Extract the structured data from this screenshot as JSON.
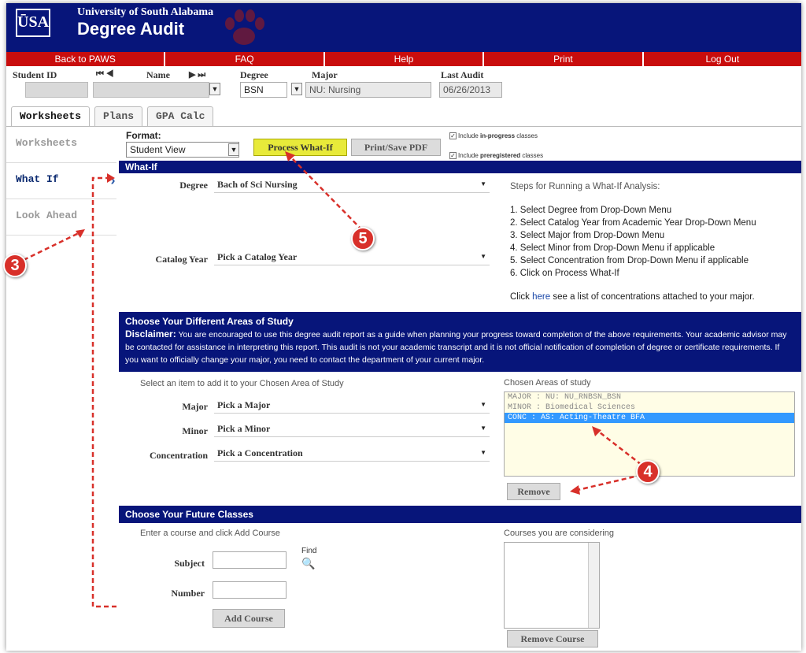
{
  "header": {
    "logo_text": "USA",
    "university": "University of South Alabama",
    "app_title": "Degree Audit"
  },
  "nav": {
    "items": [
      {
        "label": "Back to PAWS"
      },
      {
        "label": "FAQ"
      },
      {
        "label": "Help"
      },
      {
        "label": "Print"
      },
      {
        "label": "Log Out"
      }
    ]
  },
  "student_info": {
    "student_id_label": "Student ID",
    "name_label": "Name",
    "degree_label": "Degree",
    "degree_value": "BSN",
    "major_label": "Major",
    "major_value": "NU: Nursing",
    "last_audit_label": "Last Audit",
    "last_audit_value": "06/26/2013"
  },
  "tabs": [
    {
      "label": "Worksheets"
    },
    {
      "label": "Plans"
    },
    {
      "label": "GPA Calc"
    }
  ],
  "sidebar": {
    "items": [
      {
        "label": "Worksheets"
      },
      {
        "label": "What If"
      },
      {
        "label": "Look Ahead"
      }
    ]
  },
  "toolbar": {
    "format_label": "Format:",
    "format_value": "Student View",
    "process_label": "Process What-If",
    "print_label": "Print/Save PDF",
    "include_inprogress_pre": "Include ",
    "include_inprogress_bold": "in-progress",
    "include_inprogress_post": " classes",
    "include_prereg_pre": "Include ",
    "include_prereg_bold": "preregistered",
    "include_prereg_post": " classes"
  },
  "whatif": {
    "header": "What-If",
    "degree_label": "Degree",
    "degree_value": "Bach of Sci Nursing",
    "catalog_label": "Catalog Year",
    "catalog_value": "Pick a Catalog Year",
    "steps_title": "Steps for Running a What-If Analysis:",
    "steps": [
      "1. Select Degree from Drop-Down Menu",
      "2. Select Catalog Year from Academic Year Drop-Down Menu",
      "3. Select Major from Drop-Down Menu",
      "4. Select Minor from Drop-Down Menu if applicable",
      "5. Select Concentration from Drop-Down Menu if applicable",
      "6. Click on Process What-If"
    ],
    "click_here_pre": "Click ",
    "click_here_link": "here",
    "click_here_post": " see a list of concentrations attached to your major."
  },
  "areas": {
    "header": "Choose Your Different Areas of Study",
    "disclaimer_label": "Disclaimer:",
    "disclaimer_text": "You are encouraged to use this degree audit report as a guide when planning your progress toward completion of the above requirements. Your academic advisor may be contacted for assistance in interpreting this report. This audit is not your academic transcript and it is not official notification of completion of degree or certificate requirements. If you want to officially change your major, you need to contact the department of your current major.",
    "select_prompt": "Select an item to add it to your Chosen Area of Study",
    "major_label": "Major",
    "major_value": "Pick a Major",
    "minor_label": "Minor",
    "minor_value": "Pick a Minor",
    "conc_label": "Concentration",
    "conc_value": "Pick a Concentration",
    "chosen_title": "Chosen Areas of study",
    "chosen_items": [
      "MAJOR : NU: NU_RNBSN_BSN",
      "MINOR : Biomedical Sciences",
      "CONC : AS: Acting-Theatre BFA"
    ],
    "remove_label": "Remove"
  },
  "future": {
    "header": "Choose Your Future Classes",
    "prompt": "Enter a course and click Add Course",
    "subject_label": "Subject",
    "number_label": "Number",
    "find_label": "Find",
    "add_label": "Add Course",
    "considering_title": "Courses you are considering",
    "remove_label": "Remove Course"
  },
  "annotations": {
    "a3": "3",
    "a4": "4",
    "a5": "5"
  },
  "colors": {
    "banner": "#07157a",
    "nav": "#c90d0d",
    "process_button": "#e8ea3a",
    "annotation": "#d8302a",
    "selected_row": "#3399ff"
  }
}
